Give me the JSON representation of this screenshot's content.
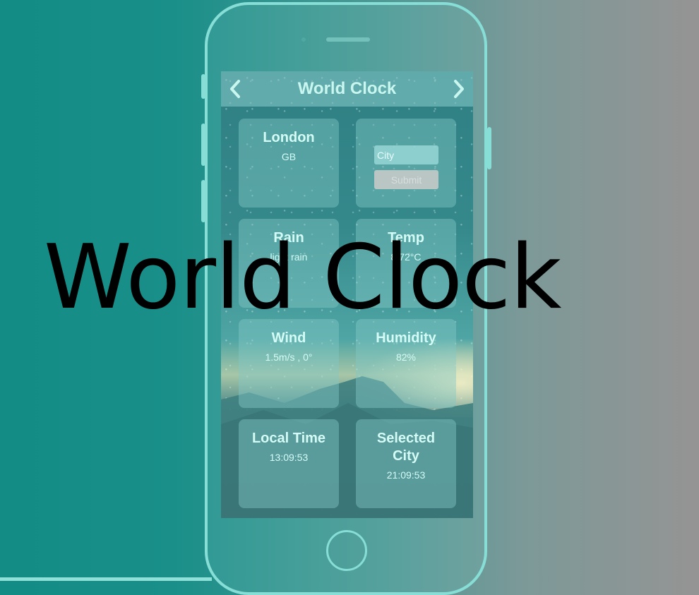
{
  "app": {
    "header_title": "World Clock",
    "overlay_title": "World Clock"
  },
  "location": {
    "city": "London",
    "country": "GB"
  },
  "search": {
    "placeholder": "City",
    "submit_label": "Submit"
  },
  "cards": {
    "rain": {
      "label": "Rain",
      "value": "light rain"
    },
    "temp": {
      "label": "Temp",
      "value": "8.72°C"
    },
    "wind": {
      "label": "Wind",
      "value": "1.5m/s , 0°"
    },
    "humidity": {
      "label": "Humidity",
      "value": "82%"
    },
    "local_time": {
      "label": "Local Time",
      "value": "13:09:53"
    },
    "selected_city": {
      "label": "Selected City",
      "value": "21:09:53"
    }
  },
  "colors": {
    "accent": "#86ded6",
    "text": "#d4fbf5"
  },
  "icons": {
    "prev": "chevron-left-icon",
    "next": "chevron-right-icon"
  }
}
